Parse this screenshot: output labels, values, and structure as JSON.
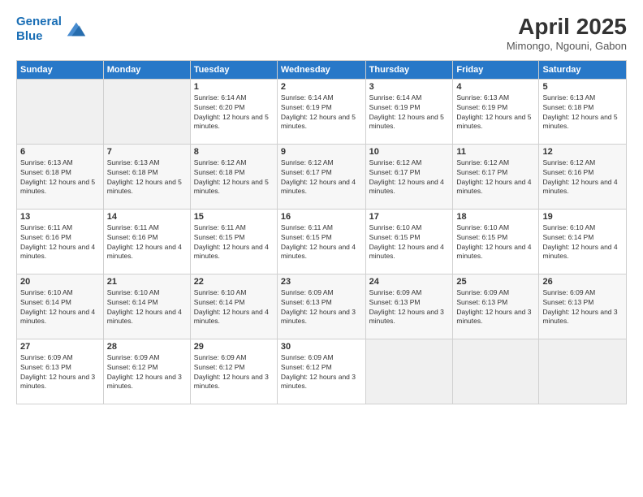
{
  "logo": {
    "line1": "General",
    "line2": "Blue"
  },
  "title": "April 2025",
  "location": "Mimongo, Ngouni, Gabon",
  "days_of_week": [
    "Sunday",
    "Monday",
    "Tuesday",
    "Wednesday",
    "Thursday",
    "Friday",
    "Saturday"
  ],
  "weeks": [
    [
      {
        "day": "",
        "info": ""
      },
      {
        "day": "",
        "info": ""
      },
      {
        "day": "1",
        "info": "Sunrise: 6:14 AM\nSunset: 6:20 PM\nDaylight: 12 hours and 5 minutes."
      },
      {
        "day": "2",
        "info": "Sunrise: 6:14 AM\nSunset: 6:19 PM\nDaylight: 12 hours and 5 minutes."
      },
      {
        "day": "3",
        "info": "Sunrise: 6:14 AM\nSunset: 6:19 PM\nDaylight: 12 hours and 5 minutes."
      },
      {
        "day": "4",
        "info": "Sunrise: 6:13 AM\nSunset: 6:19 PM\nDaylight: 12 hours and 5 minutes."
      },
      {
        "day": "5",
        "info": "Sunrise: 6:13 AM\nSunset: 6:18 PM\nDaylight: 12 hours and 5 minutes."
      }
    ],
    [
      {
        "day": "6",
        "info": "Sunrise: 6:13 AM\nSunset: 6:18 PM\nDaylight: 12 hours and 5 minutes."
      },
      {
        "day": "7",
        "info": "Sunrise: 6:13 AM\nSunset: 6:18 PM\nDaylight: 12 hours and 5 minutes."
      },
      {
        "day": "8",
        "info": "Sunrise: 6:12 AM\nSunset: 6:18 PM\nDaylight: 12 hours and 5 minutes."
      },
      {
        "day": "9",
        "info": "Sunrise: 6:12 AM\nSunset: 6:17 PM\nDaylight: 12 hours and 4 minutes."
      },
      {
        "day": "10",
        "info": "Sunrise: 6:12 AM\nSunset: 6:17 PM\nDaylight: 12 hours and 4 minutes."
      },
      {
        "day": "11",
        "info": "Sunrise: 6:12 AM\nSunset: 6:17 PM\nDaylight: 12 hours and 4 minutes."
      },
      {
        "day": "12",
        "info": "Sunrise: 6:12 AM\nSunset: 6:16 PM\nDaylight: 12 hours and 4 minutes."
      }
    ],
    [
      {
        "day": "13",
        "info": "Sunrise: 6:11 AM\nSunset: 6:16 PM\nDaylight: 12 hours and 4 minutes."
      },
      {
        "day": "14",
        "info": "Sunrise: 6:11 AM\nSunset: 6:16 PM\nDaylight: 12 hours and 4 minutes."
      },
      {
        "day": "15",
        "info": "Sunrise: 6:11 AM\nSunset: 6:15 PM\nDaylight: 12 hours and 4 minutes."
      },
      {
        "day": "16",
        "info": "Sunrise: 6:11 AM\nSunset: 6:15 PM\nDaylight: 12 hours and 4 minutes."
      },
      {
        "day": "17",
        "info": "Sunrise: 6:10 AM\nSunset: 6:15 PM\nDaylight: 12 hours and 4 minutes."
      },
      {
        "day": "18",
        "info": "Sunrise: 6:10 AM\nSunset: 6:15 PM\nDaylight: 12 hours and 4 minutes."
      },
      {
        "day": "19",
        "info": "Sunrise: 6:10 AM\nSunset: 6:14 PM\nDaylight: 12 hours and 4 minutes."
      }
    ],
    [
      {
        "day": "20",
        "info": "Sunrise: 6:10 AM\nSunset: 6:14 PM\nDaylight: 12 hours and 4 minutes."
      },
      {
        "day": "21",
        "info": "Sunrise: 6:10 AM\nSunset: 6:14 PM\nDaylight: 12 hours and 4 minutes."
      },
      {
        "day": "22",
        "info": "Sunrise: 6:10 AM\nSunset: 6:14 PM\nDaylight: 12 hours and 4 minutes."
      },
      {
        "day": "23",
        "info": "Sunrise: 6:09 AM\nSunset: 6:13 PM\nDaylight: 12 hours and 3 minutes."
      },
      {
        "day": "24",
        "info": "Sunrise: 6:09 AM\nSunset: 6:13 PM\nDaylight: 12 hours and 3 minutes."
      },
      {
        "day": "25",
        "info": "Sunrise: 6:09 AM\nSunset: 6:13 PM\nDaylight: 12 hours and 3 minutes."
      },
      {
        "day": "26",
        "info": "Sunrise: 6:09 AM\nSunset: 6:13 PM\nDaylight: 12 hours and 3 minutes."
      }
    ],
    [
      {
        "day": "27",
        "info": "Sunrise: 6:09 AM\nSunset: 6:13 PM\nDaylight: 12 hours and 3 minutes."
      },
      {
        "day": "28",
        "info": "Sunrise: 6:09 AM\nSunset: 6:12 PM\nDaylight: 12 hours and 3 minutes."
      },
      {
        "day": "29",
        "info": "Sunrise: 6:09 AM\nSunset: 6:12 PM\nDaylight: 12 hours and 3 minutes."
      },
      {
        "day": "30",
        "info": "Sunrise: 6:09 AM\nSunset: 6:12 PM\nDaylight: 12 hours and 3 minutes."
      },
      {
        "day": "",
        "info": ""
      },
      {
        "day": "",
        "info": ""
      },
      {
        "day": "",
        "info": ""
      }
    ]
  ]
}
